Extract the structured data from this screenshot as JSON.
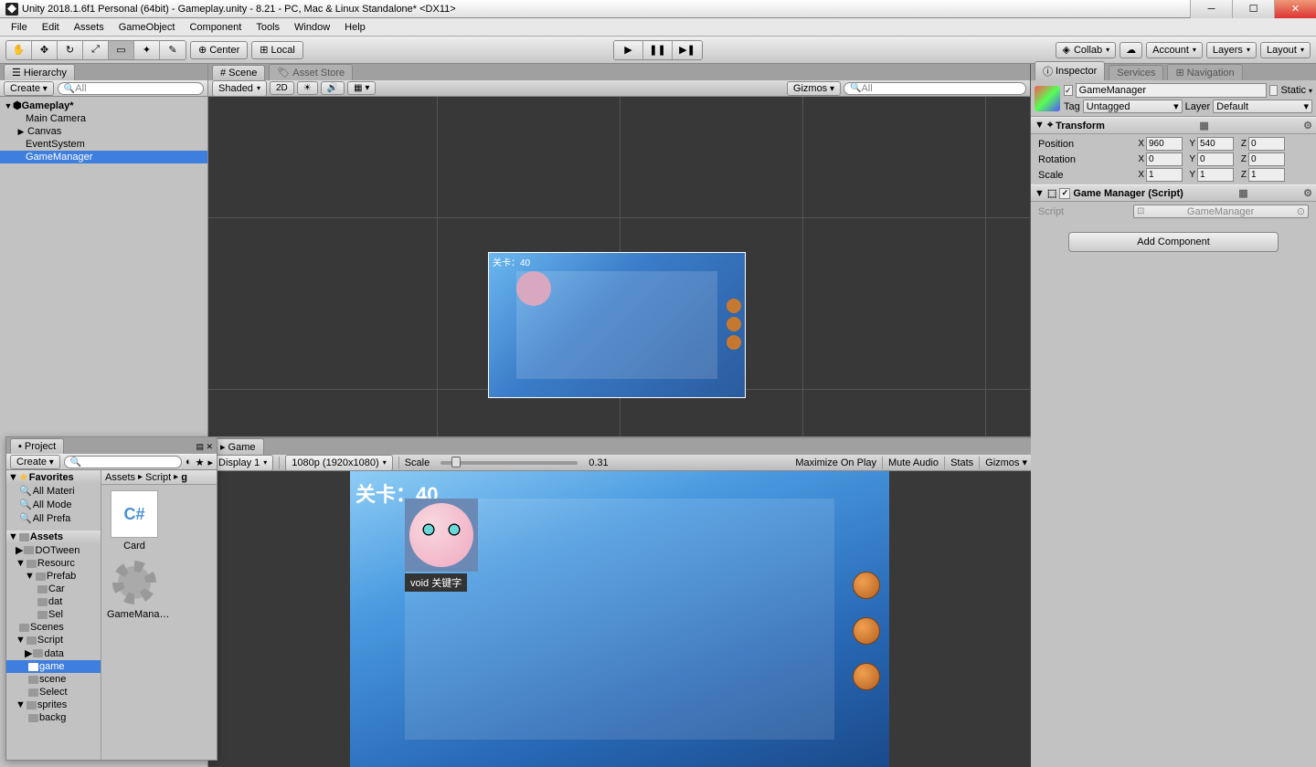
{
  "window": {
    "title": "Unity 2018.1.6f1 Personal (64bit) - Gameplay.unity - 8.21 - PC, Mac & Linux Standalone* <DX11>"
  },
  "menu": [
    "File",
    "Edit",
    "Assets",
    "GameObject",
    "Component",
    "Tools",
    "Window",
    "Help"
  ],
  "toolbar": {
    "center": "Center",
    "local": "Local",
    "collab": "Collab",
    "account": "Account",
    "layers": "Layers",
    "layout": "Layout"
  },
  "hierarchy": {
    "tab": "Hierarchy",
    "create": "Create",
    "search_placeholder": "All",
    "scene": "Gameplay*",
    "items": [
      {
        "name": "Main Camera",
        "indent": 1,
        "fold": ""
      },
      {
        "name": "Canvas",
        "indent": 1,
        "fold": "▶"
      },
      {
        "name": "EventSystem",
        "indent": 1,
        "fold": ""
      },
      {
        "name": "GameManager",
        "indent": 1,
        "fold": "",
        "selected": true
      }
    ]
  },
  "scene": {
    "tab_scene": "Scene",
    "tab_asset": "Asset Store",
    "shaded": "Shaded",
    "mode_2d": "2D",
    "gizmos": "Gizmos",
    "search_placeholder": "All",
    "level_text": "关卡：40"
  },
  "game": {
    "tab": "Game",
    "display": "Display 1",
    "resolution": "1080p (1920x1080)",
    "scale_label": "Scale",
    "scale_value": "0.31",
    "maximize": "Maximize On Play",
    "mute": "Mute Audio",
    "stats": "Stats",
    "gizmos": "Gizmos",
    "level_text": "关卡：40",
    "tooltip": "void 关键字"
  },
  "project": {
    "tab": "Project",
    "create": "Create",
    "favorites_label": "Favorites",
    "favorites": [
      "All Materi",
      "All Mode",
      "All Prefa"
    ],
    "assets_label": "Assets",
    "tree": [
      {
        "name": "DOTween",
        "indent": 1,
        "fold": "▶"
      },
      {
        "name": "Resourc",
        "indent": 1,
        "fold": "▼"
      },
      {
        "name": "Prefab",
        "indent": 2,
        "fold": "▼"
      },
      {
        "name": "Car",
        "indent": 3,
        "fold": ""
      },
      {
        "name": "dat",
        "indent": 3,
        "fold": ""
      },
      {
        "name": "Sel",
        "indent": 3,
        "fold": ""
      },
      {
        "name": "Scenes",
        "indent": 1,
        "fold": ""
      },
      {
        "name": "Script",
        "indent": 1,
        "fold": "▼"
      },
      {
        "name": "data",
        "indent": 2,
        "fold": "▶"
      },
      {
        "name": "game",
        "indent": 2,
        "fold": "",
        "selected": true
      },
      {
        "name": "scene",
        "indent": 2,
        "fold": ""
      },
      {
        "name": "Select",
        "indent": 2,
        "fold": ""
      },
      {
        "name": "sprites",
        "indent": 1,
        "fold": "▼"
      },
      {
        "name": "backg",
        "indent": 2,
        "fold": ""
      }
    ],
    "crumb": [
      "Assets",
      "Script",
      "g"
    ],
    "assets": [
      {
        "name": "Card",
        "type": "cs"
      },
      {
        "name": "GameMana…",
        "type": "gear"
      }
    ]
  },
  "inspector": {
    "tab_inspector": "Inspector",
    "tab_services": "Services",
    "tab_navigation": "Navigation",
    "object_name": "GameManager",
    "static": "Static",
    "tag_label": "Tag",
    "tag_value": "Untagged",
    "layer_label": "Layer",
    "layer_value": "Default",
    "transform": {
      "title": "Transform",
      "position": {
        "label": "Position",
        "x": "960",
        "y": "540",
        "z": "0"
      },
      "rotation": {
        "label": "Rotation",
        "x": "0",
        "y": "0",
        "z": "0"
      },
      "scale": {
        "label": "Scale",
        "x": "1",
        "y": "1",
        "z": "1"
      }
    },
    "script_comp": {
      "title": "Game Manager (Script)",
      "script_label": "Script",
      "script_value": "GameManager"
    },
    "add_component": "Add Component"
  }
}
